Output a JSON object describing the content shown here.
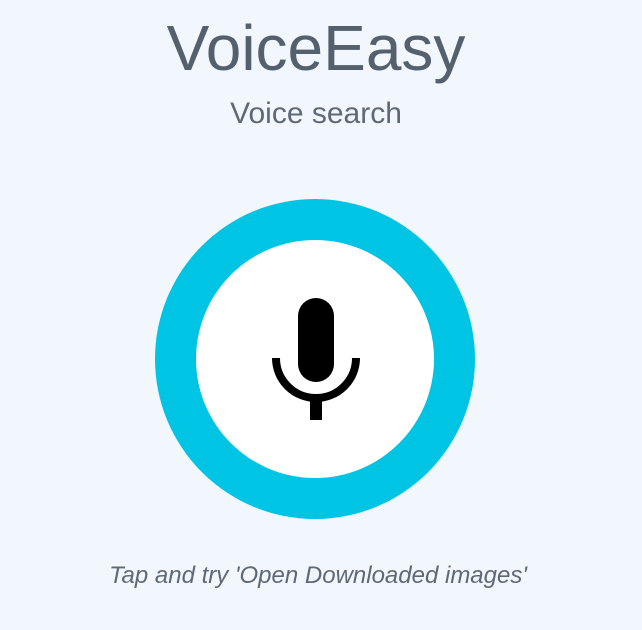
{
  "app": {
    "title": "VoiceEasy",
    "subtitle": "Voice search"
  },
  "mic_button": {
    "icon": "microphone-icon",
    "ring_color": "#00c4e3",
    "inner_color": "#ffffff"
  },
  "hint": {
    "text": "Tap and try 'Open Downloaded images'"
  },
  "colors": {
    "background": "#f1f7fd",
    "text": "#55606e"
  }
}
